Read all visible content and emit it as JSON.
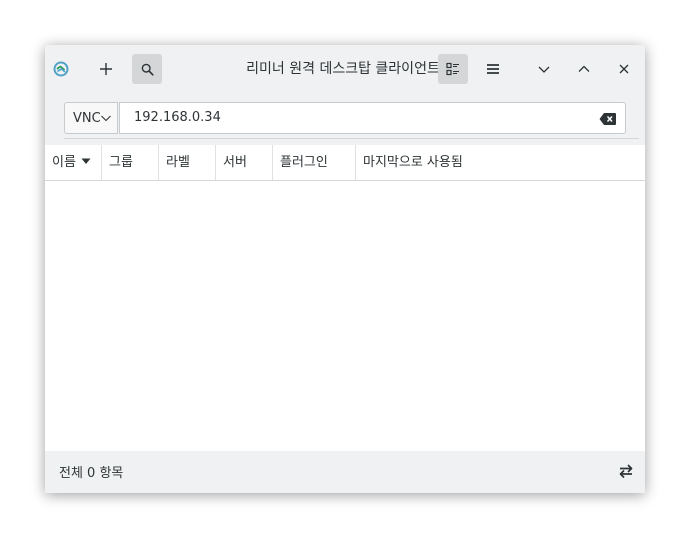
{
  "window": {
    "title": "리미너 원격 데스크탑 클라이언트"
  },
  "toolbar": {
    "protocol": "VNC",
    "address": "192.168.0.34"
  },
  "columns": [
    {
      "label": "이름"
    },
    {
      "label": "그룹"
    },
    {
      "label": "라벨"
    },
    {
      "label": "서버"
    },
    {
      "label": "플러그인"
    },
    {
      "label": "마지막으로 사용됨"
    }
  ],
  "status": {
    "count_text": "전체 0 항목"
  },
  "icons": {
    "app": "remmina-icon",
    "new": "plus-icon",
    "search": "search-icon",
    "view": "list-view-icon",
    "menu": "hamburger-menu-icon",
    "minimize": "chevron-down-icon",
    "maximize": "chevron-up-icon",
    "close": "close-icon",
    "clear": "backspace-icon",
    "swap": "swap-arrows-icon"
  },
  "colors": {
    "app_icon": "#4fa3c7",
    "app_icon_accent": "#2f9a5c"
  }
}
